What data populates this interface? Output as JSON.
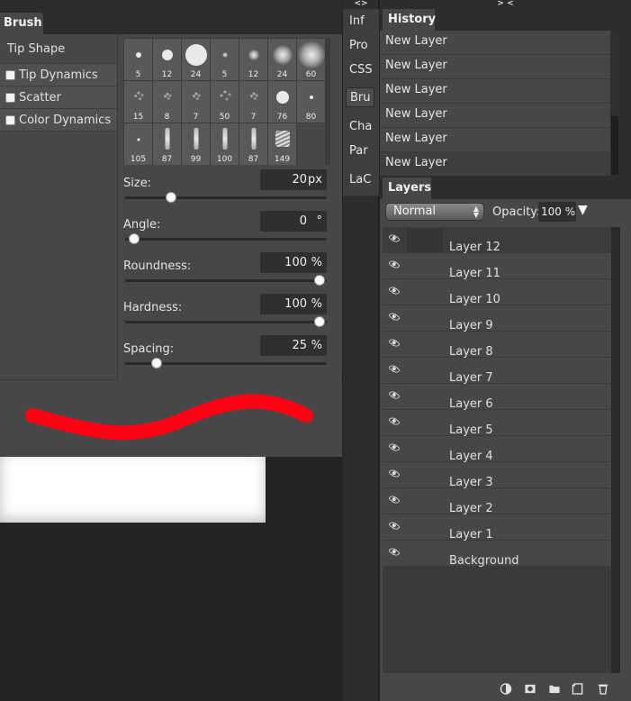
{
  "brush": {
    "tab_label": "Brush",
    "tip_shape": "Tip Shape",
    "options": [
      "Tip Dynamics",
      "Scatter",
      "Color Dynamics"
    ],
    "presets": [
      {
        "size": "5",
        "kind": "hard",
        "d": 6
      },
      {
        "size": "12",
        "kind": "hard",
        "d": 12
      },
      {
        "size": "24",
        "kind": "hard",
        "d": 24
      },
      {
        "size": "5",
        "kind": "soft",
        "d": 6
      },
      {
        "size": "12",
        "kind": "soft",
        "d": 12
      },
      {
        "size": "24",
        "kind": "soft",
        "d": 22
      },
      {
        "size": "60",
        "kind": "soft",
        "d": 30
      },
      {
        "size": "15",
        "kind": "spatter",
        "d": 10
      },
      {
        "size": "8",
        "kind": "spatter",
        "d": 6
      },
      {
        "size": "7",
        "kind": "spatter",
        "d": 7
      },
      {
        "size": "50",
        "kind": "spatter",
        "d": 14
      },
      {
        "size": "7",
        "kind": "spatter",
        "d": 7
      },
      {
        "size": "76",
        "kind": "hard",
        "d": 14
      },
      {
        "size": "80",
        "kind": "hard",
        "d": 4
      },
      {
        "size": "105",
        "kind": "hard",
        "d": 3
      },
      {
        "size": "87",
        "kind": "stroke",
        "d": 0
      },
      {
        "size": "99",
        "kind": "stroke",
        "d": 0
      },
      {
        "size": "100",
        "kind": "stroke",
        "d": 0
      },
      {
        "size": "87",
        "kind": "stroke",
        "d": 0
      },
      {
        "size": "149",
        "kind": "tex",
        "d": 0
      }
    ],
    "params": [
      {
        "label": "Size:",
        "value": "20",
        "unit": "px",
        "fraction": 0.2
      },
      {
        "label": "Angle:",
        "value": "0",
        "unit": "°",
        "fraction": 0.0
      },
      {
        "label": "Roundness:",
        "value": "100",
        "unit": "%",
        "fraction": 1.0
      },
      {
        "label": "Hardness:",
        "value": "100",
        "unit": "%",
        "fraction": 1.0
      },
      {
        "label": "Spacing:",
        "value": "25",
        "unit": "%",
        "fraction": 0.12
      }
    ],
    "preview_color": "#ff0015"
  },
  "toolbar": {
    "collapse_label": "<>",
    "items": [
      "Inf",
      "Pro",
      "CSS",
      "Bru",
      "Cha",
      "Par",
      "LaC"
    ],
    "active_index": 3
  },
  "right_collapse_label": "> <",
  "history": {
    "tab_label": "History",
    "items": [
      "New Layer",
      "New Layer",
      "New Layer",
      "New Layer",
      "New Layer",
      "New Layer"
    ]
  },
  "layers": {
    "tab_label": "Layers",
    "blend_mode": "Normal",
    "opacity_label": "Opacity:",
    "opacity_value": "100 %",
    "items": [
      "Layer 12",
      "Layer 11",
      "Layer 10",
      "Layer 9",
      "Layer 8",
      "Layer 7",
      "Layer 6",
      "Layer 5",
      "Layer 4",
      "Layer 3",
      "Layer 2",
      "Layer 1",
      "Background"
    ]
  }
}
